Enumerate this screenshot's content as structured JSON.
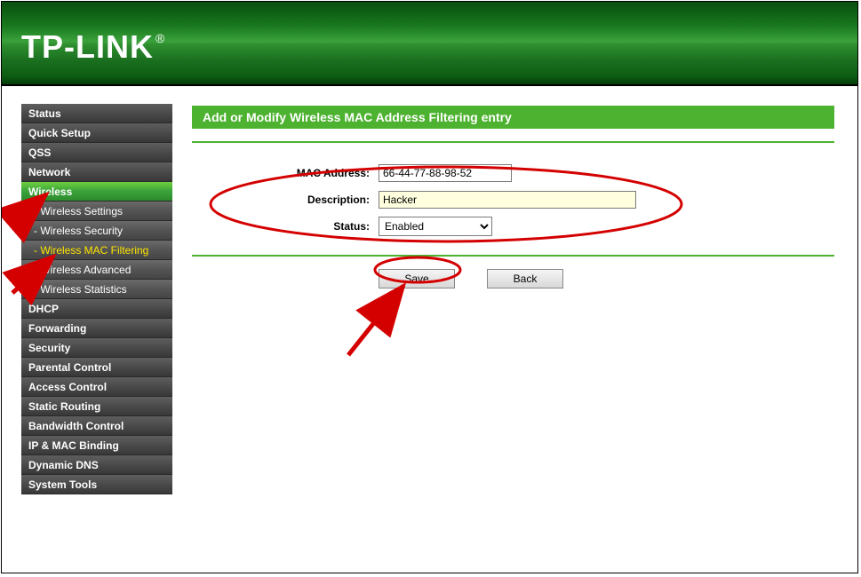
{
  "brand": "TP-LINK",
  "sidebar": {
    "items": [
      {
        "label": "Status"
      },
      {
        "label": "Quick Setup"
      },
      {
        "label": "QSS"
      },
      {
        "label": "Network"
      },
      {
        "label": "Wireless",
        "selected": true
      },
      {
        "label": "DHCP"
      },
      {
        "label": "Forwarding"
      },
      {
        "label": "Security"
      },
      {
        "label": "Parental Control"
      },
      {
        "label": "Access Control"
      },
      {
        "label": "Static Routing"
      },
      {
        "label": "Bandwidth Control"
      },
      {
        "label": "IP & MAC Binding"
      },
      {
        "label": "Dynamic DNS"
      },
      {
        "label": "System Tools"
      }
    ],
    "wireless_sub": [
      {
        "label": "- Wireless Settings"
      },
      {
        "label": "- Wireless Security"
      },
      {
        "label": "- Wireless MAC Filtering",
        "selected": true
      },
      {
        "label": "- Wireless Advanced"
      },
      {
        "label": "- Wireless Statistics"
      }
    ]
  },
  "page": {
    "title": "Add or Modify Wireless MAC Address Filtering entry",
    "labels": {
      "mac": "MAC Address:",
      "desc": "Description:",
      "status": "Status:"
    },
    "values": {
      "mac": "66-44-77-88-98-52",
      "desc": "Hacker",
      "status": "Enabled"
    },
    "buttons": {
      "save": "Save",
      "back": "Back"
    }
  }
}
